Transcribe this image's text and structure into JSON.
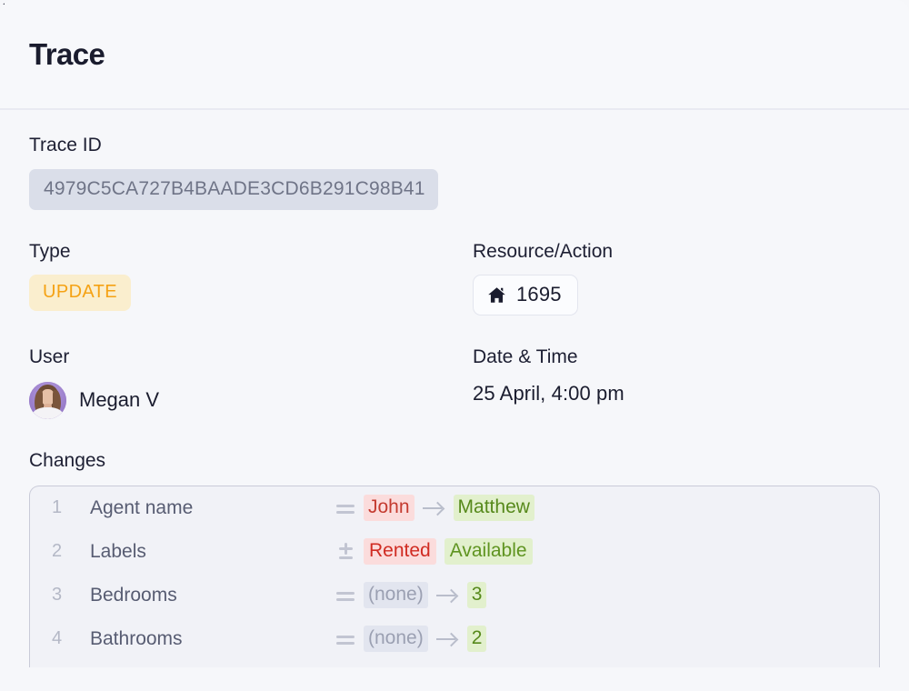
{
  "header": {
    "title": "Trace"
  },
  "fields": {
    "trace_id_label": "Trace ID",
    "trace_id_value": "4979C5CA727B4BAADE3CD6B291C98B41",
    "type_label": "Type",
    "type_value": "UPDATE",
    "resource_label": "Resource/Action",
    "resource_icon": "house-icon",
    "resource_value": "1695",
    "user_label": "User",
    "user_name": "Megan V",
    "datetime_label": "Date & Time",
    "datetime_value": "25 April, 4:00 pm"
  },
  "changes": {
    "label": "Changes",
    "rows": [
      {
        "num": "1",
        "field": "Agent name",
        "op": "equal",
        "old": "John",
        "arrow": true,
        "new": "Matthew"
      },
      {
        "num": "2",
        "field": "Labels",
        "op": "plusminus",
        "old": "Rented",
        "arrow": false,
        "new": "Available"
      },
      {
        "num": "3",
        "field": "Bedrooms",
        "op": "equal",
        "old": "(none)",
        "arrow": true,
        "new": "3"
      },
      {
        "num": "4",
        "field": "Bathrooms",
        "op": "equal",
        "old": "(none)",
        "arrow": true,
        "new": "2"
      }
    ]
  },
  "colors": {
    "page_bg": "#f6f7fa",
    "title": "#1a1c2e",
    "badge_bg": "#faeece",
    "badge_text": "#f5a214",
    "trace_id_bg": "#dadee9",
    "trace_id_text": "#6f7487",
    "removed_bg": "#fbdcdc",
    "removed_text": "#c43b30",
    "added_bg": "#e2f0cd",
    "added_text": "#56891b",
    "none_bg": "#e2e5ef",
    "none_text": "#9ba0b2"
  }
}
